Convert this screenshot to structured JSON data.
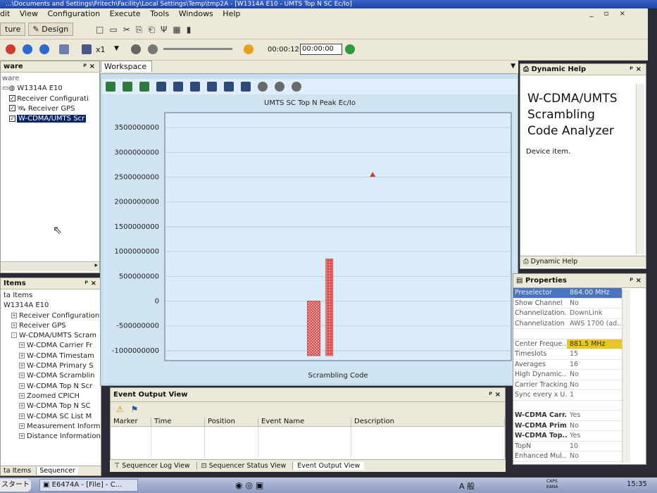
{
  "window": {
    "title": "...\\Documents and Settings\\Fritech\\Facility\\Local Settings\\Temp\\tmp2A - [W1314A E10 - UMTS Top N SC Ec/Io]"
  },
  "menu": [
    "dit",
    "View",
    "Configuration",
    "Execute",
    "Tools",
    "Windows",
    "Help"
  ],
  "toolbar": {
    "tab_left": "ture",
    "tab_design": "Design",
    "speed": "x1",
    "elapsed": "00:00:12",
    "time_input": "00:00:00"
  },
  "hardware_panel": {
    "title": "ware",
    "root_label": "ware",
    "items": [
      {
        "label": "W1314A E10",
        "checked": null
      },
      {
        "label": "Receiver Configurati",
        "checked": true
      },
      {
        "label": "Receiver GPS",
        "checked": true
      },
      {
        "label": "W-CDMA/UMTS Scr",
        "checked": true,
        "selected": true
      }
    ]
  },
  "data_items_panel": {
    "title": "Items",
    "items": [
      {
        "label": "ta Items",
        "depth": 0,
        "toggle": ""
      },
      {
        "label": "W1314A E10",
        "depth": 0,
        "toggle": ""
      },
      {
        "label": "Receiver Configuration",
        "depth": 1,
        "toggle": "+"
      },
      {
        "label": "Receiver GPS",
        "depth": 1,
        "toggle": "+"
      },
      {
        "label": "W-CDMA/UMTS Scram",
        "depth": 1,
        "toggle": "-"
      },
      {
        "label": "W-CDMA Carrier Fr",
        "depth": 2,
        "toggle": "+"
      },
      {
        "label": "W-CDMA Timestam",
        "depth": 2,
        "toggle": "+"
      },
      {
        "label": "W-CDMA Primary S",
        "depth": 2,
        "toggle": "+"
      },
      {
        "label": "W-CDMA Scramblin",
        "depth": 2,
        "toggle": "+"
      },
      {
        "label": "W-CDMA Top N Scr",
        "depth": 2,
        "toggle": "+"
      },
      {
        "label": "Zoomed CPICH",
        "depth": 2,
        "toggle": "+"
      },
      {
        "label": "W-CDMA Top N SC",
        "depth": 2,
        "toggle": "+"
      },
      {
        "label": "W-CDMA SC List M",
        "depth": 2,
        "toggle": "+"
      },
      {
        "label": "Measurement Inform",
        "depth": 2,
        "toggle": "+"
      },
      {
        "label": "Distance Information",
        "depth": 2,
        "toggle": "+"
      }
    ],
    "bottom_tabs": [
      "ta Items",
      "Sequencer"
    ]
  },
  "workspace": {
    "tab": "Workspace 1"
  },
  "chart_data": {
    "type": "bar",
    "title": "UMTS SC Top N Peak Ec/Io",
    "xlabel": "Scrambling Code",
    "ylabel": "",
    "ylim": [
      -1200000000,
      3800000000
    ],
    "yticks": [
      3500000000,
      3000000000,
      2500000000,
      2000000000,
      1500000000,
      1000000000,
      500000000,
      0,
      -500000000,
      -1000000000
    ],
    "bars": [
      {
        "x": 0.43,
        "bottom": -1100000000,
        "top": 0,
        "color": "#c93a3a",
        "pattern": "cross"
      },
      {
        "x": 0.475,
        "bottom": -1100000000,
        "top": 850000000,
        "color": "#d83a3a",
        "pattern": "grid"
      }
    ],
    "marker": {
      "x": 0.6,
      "y": 2550000000,
      "color": "#d33a2a",
      "shape": "triangle"
    },
    "grid": true,
    "colors": {
      "plot_bg": "#d9ecf7",
      "panel_bg": "#cfe3f1"
    }
  },
  "event_output": {
    "title": "Event Output View",
    "columns": [
      "Marker",
      "Time",
      "Position",
      "Event Name",
      "Description"
    ],
    "bottom_tabs": [
      "Sequencer Log View",
      "Sequencer Status View",
      "Event Output View"
    ]
  },
  "dynamic_help": {
    "title": "Dynamic Help",
    "heading": "W-CDMA/UMTS Scrambling Code Analyzer",
    "body": "Device item.",
    "footer_tab": "Dynamic Help"
  },
  "properties": {
    "title": "Properties",
    "rows": [
      {
        "key": "Preselector",
        "value": "864.00 MHz",
        "style": "head"
      },
      {
        "key": "Show Channel",
        "value": "No",
        "style": ""
      },
      {
        "key": "Channelization...",
        "value": "DownLink",
        "style": ""
      },
      {
        "key": "Channelization",
        "value": "AWS 1700 (ad...",
        "style": ""
      },
      {
        "key": "",
        "value": "",
        "style": ""
      },
      {
        "key": "Center Freque...",
        "value": "881.5 MHz",
        "style": "hl"
      },
      {
        "key": "Timeslots",
        "value": "15",
        "style": ""
      },
      {
        "key": "Averages",
        "value": "16",
        "style": ""
      },
      {
        "key": "High Dynamic...",
        "value": "No",
        "style": ""
      },
      {
        "key": "Carrier Tracking",
        "value": "No",
        "style": ""
      },
      {
        "key": "Sync every x U...",
        "value": "1",
        "style": ""
      },
      {
        "key": "",
        "value": "",
        "style": ""
      },
      {
        "key": "W-CDMA Carr...",
        "value": "Yes",
        "style": "bold"
      },
      {
        "key": "W-CDMA Prim...",
        "value": "No",
        "style": "bold"
      },
      {
        "key": "W-CDMA Top...",
        "value": "Yes",
        "style": "bold"
      },
      {
        "key": "TopN",
        "value": "10",
        "style": ""
      },
      {
        "key": "Enhanced Mul...",
        "value": "No",
        "style": ""
      }
    ]
  },
  "taskbar": {
    "start": "スタート",
    "task": "E6474A - [File] - C...",
    "ime": "A 般",
    "caps": "CAPS",
    "kana": "KANA",
    "clock": "15:35"
  }
}
